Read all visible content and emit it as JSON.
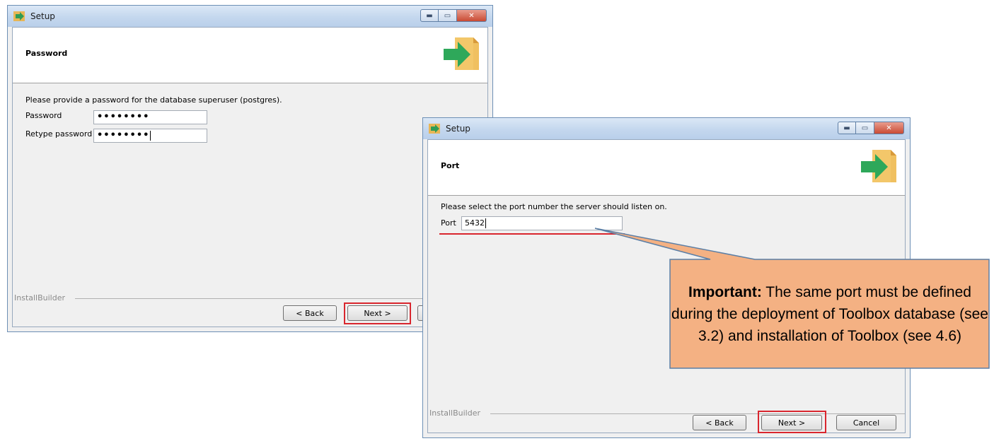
{
  "window1": {
    "title": "Setup",
    "header_title": "Password",
    "prompt": "Please provide a password for the database superuser (postgres).",
    "password_label": "Password",
    "password_value": "••••••••",
    "retype_label": "Retype password",
    "retype_value": "••••••••",
    "installbuilder": "InstallBuilder",
    "back_label": "< Back",
    "next_label": "Next >"
  },
  "window2": {
    "title": "Setup",
    "header_title": "Port",
    "prompt": "Please select the port number the server should listen on.",
    "port_label": "Port",
    "port_value": "5432",
    "installbuilder": "InstallBuilder",
    "back_label": "< Back",
    "next_label": "Next >",
    "cancel_label": "Cancel"
  },
  "callout": {
    "bold": "Important:",
    "text": " The same port must be defined during the deployment of Toolbox database (see 3.2) and installation of Toolbox (see 4.6)"
  },
  "colors": {
    "highlight": "#d9262e",
    "callout_fill": "#f4b183",
    "callout_border": "#5b7fa6"
  }
}
